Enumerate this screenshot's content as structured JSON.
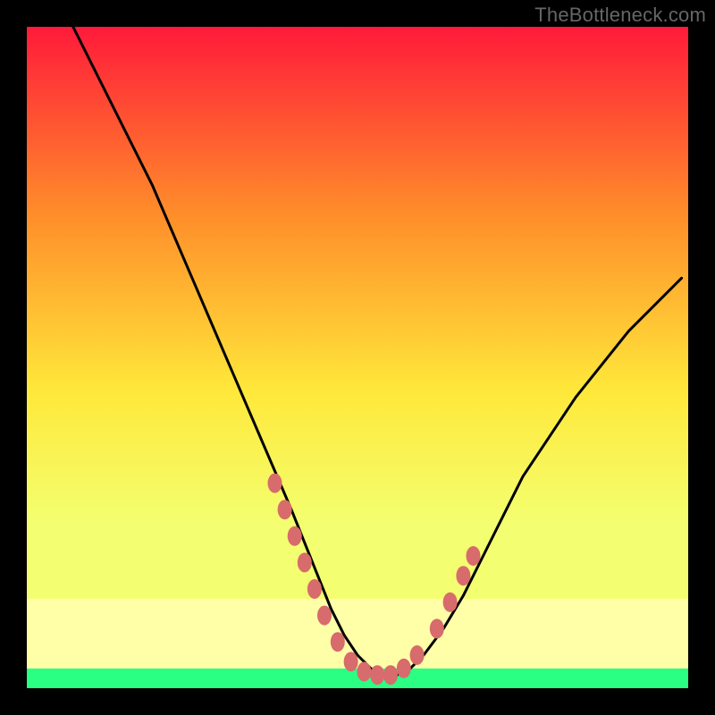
{
  "watermark": "TheBottleneck.com",
  "chart_data": {
    "type": "line",
    "title": "",
    "xlabel": "",
    "ylabel": "",
    "xlim": [
      0,
      100
    ],
    "ylim": [
      0,
      100
    ],
    "background_gradient": {
      "top": "#ff1a3a",
      "mid_upper": "#ff8c2a",
      "mid": "#ffe83a",
      "lower": "#f3ff70",
      "band_light": "#ffffa0",
      "bottom": "#2aff84"
    },
    "series": [
      {
        "name": "bottleneck-curve",
        "stroke": "#000000",
        "x": [
          7,
          10,
          13,
          16,
          19,
          22,
          25,
          28,
          31,
          34,
          37,
          40,
          42,
          44,
          46,
          48,
          50,
          52,
          54,
          56,
          58,
          60,
          63,
          66,
          69,
          72,
          75,
          79,
          83,
          87,
          91,
          95,
          99
        ],
        "y": [
          100,
          94,
          88,
          82,
          76,
          69,
          62,
          55,
          48,
          41,
          34,
          27,
          22,
          17,
          12,
          8,
          5,
          3,
          2,
          2,
          3,
          5,
          9,
          14,
          20,
          26,
          32,
          38,
          44,
          49,
          54,
          58,
          62
        ]
      }
    ],
    "markers": {
      "name": "highlight-dots",
      "fill": "#d86b6b",
      "points": [
        {
          "x": 37.5,
          "y": 31
        },
        {
          "x": 39.0,
          "y": 27
        },
        {
          "x": 40.5,
          "y": 23
        },
        {
          "x": 42.0,
          "y": 19
        },
        {
          "x": 43.5,
          "y": 15
        },
        {
          "x": 45.0,
          "y": 11
        },
        {
          "x": 47.0,
          "y": 7
        },
        {
          "x": 49.0,
          "y": 4
        },
        {
          "x": 51.0,
          "y": 2.5
        },
        {
          "x": 53.0,
          "y": 2
        },
        {
          "x": 55.0,
          "y": 2
        },
        {
          "x": 57.0,
          "y": 3
        },
        {
          "x": 59.0,
          "y": 5
        },
        {
          "x": 62.0,
          "y": 9
        },
        {
          "x": 64.0,
          "y": 13
        },
        {
          "x": 66.0,
          "y": 17
        },
        {
          "x": 67.5,
          "y": 20
        }
      ]
    }
  }
}
